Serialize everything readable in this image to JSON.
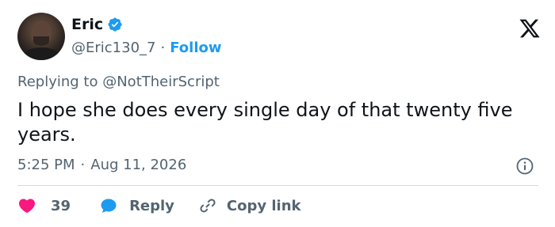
{
  "user": {
    "name": "Eric",
    "handle": "@Eric130_7",
    "separator": "·",
    "follow_label": "Follow"
  },
  "reply_context": {
    "prefix": "Replying to",
    "mention": "@NotTheirScript"
  },
  "tweet": {
    "text": "I hope she does every single day of that twenty five years."
  },
  "meta": {
    "time": "5:25 PM",
    "separator": "·",
    "date": "Aug 11, 2026"
  },
  "actions": {
    "like_count": "39",
    "reply_label": "Reply",
    "copy_label": "Copy link"
  },
  "colors": {
    "accent": "#1d9bf0",
    "like": "#f91880",
    "secondary_text": "#536471",
    "primary_text": "#0f1419",
    "divider": "#cfd9de"
  },
  "icons": {
    "verified": "verified-badge-icon",
    "platform": "x-logo-icon",
    "info": "info-icon",
    "like": "heart-icon",
    "reply": "speech-bubble-icon",
    "copy": "link-icon"
  }
}
